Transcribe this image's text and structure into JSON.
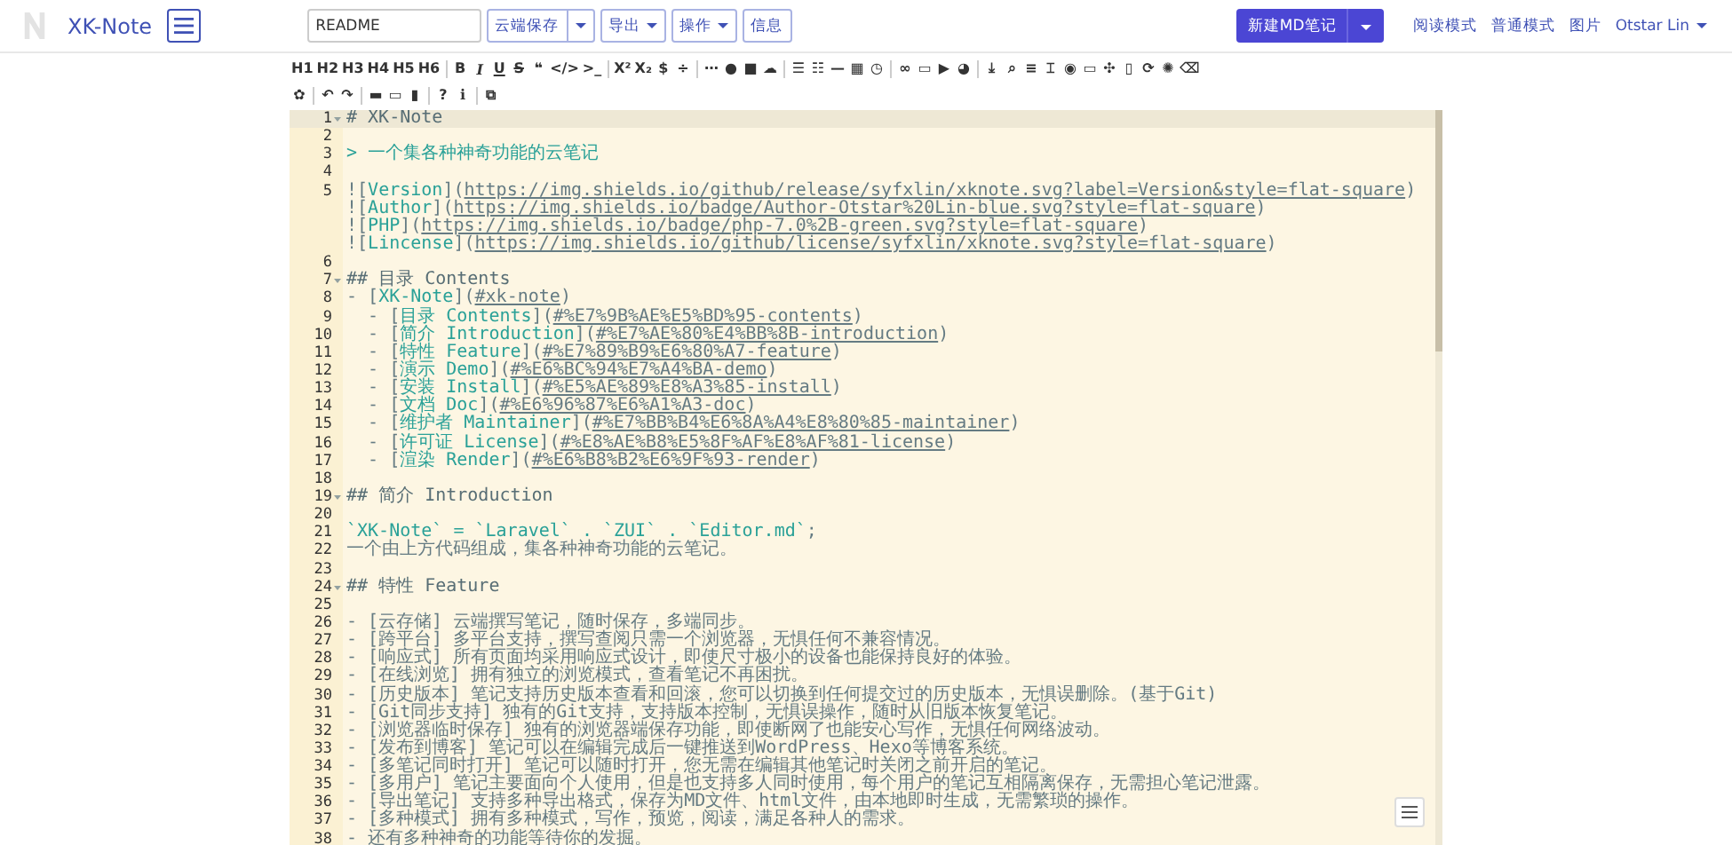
{
  "navbar": {
    "brand": "XK-Note",
    "filename": {
      "value": "README"
    },
    "buttons": [
      {
        "label": "云端保存",
        "kind": "split"
      },
      {
        "label": "导出",
        "kind": "dropdown"
      },
      {
        "label": "操作",
        "kind": "dropdown"
      },
      {
        "label": "信息",
        "kind": "plain"
      }
    ],
    "new_button": {
      "label": "新建MD笔记",
      "kind": "split"
    },
    "links": [
      "阅读模式",
      "普通模式",
      "图片"
    ],
    "user": {
      "label": "Otstar Lin",
      "kind": "dropdown"
    }
  },
  "toolbar": {
    "rows": [
      {
        "groups": [
          {
            "buttons": [
              {
                "text": "H1",
                "kind": "plain"
              },
              {
                "text": "H2",
                "kind": "plain"
              },
              {
                "text": "H3",
                "kind": "plain"
              },
              {
                "text": "H4",
                "kind": "plain"
              },
              {
                "text": "H5",
                "kind": "plain"
              },
              {
                "text": "H6",
                "kind": "plain"
              }
            ]
          },
          {
            "buttons": [
              {
                "text": "B",
                "kind": "bold"
              },
              {
                "text": "I",
                "kind": "italic"
              },
              {
                "text": "U",
                "kind": "underline"
              },
              {
                "text": "S",
                "kind": "strike"
              },
              {
                "text": "❝",
                "kind": "plain"
              },
              {
                "text": "</>",
                "kind": "plain"
              },
              {
                "text": ">_",
                "kind": "plain"
              }
            ]
          },
          {
            "buttons": [
              {
                "text": "X²",
                "kind": "plain"
              },
              {
                "text": "X₂",
                "kind": "plain"
              },
              {
                "text": "$",
                "kind": "plain"
              },
              {
                "text": "÷",
                "kind": "plain"
              }
            ]
          },
          {
            "buttons": [
              {
                "text": "⋯",
                "kind": "plain"
              },
              {
                "text": "●",
                "kind": "plain"
              },
              {
                "text": "■",
                "kind": "plain"
              },
              {
                "text": "☁",
                "kind": "plain"
              }
            ]
          },
          {
            "buttons": [
              {
                "text": "☰",
                "kind": "plain"
              },
              {
                "text": "☷",
                "kind": "plain"
              },
              {
                "text": "—",
                "kind": "plain"
              },
              {
                "text": "▦",
                "kind": "plain"
              },
              {
                "text": "◷",
                "kind": "plain"
              }
            ]
          },
          {
            "buttons": [
              {
                "text": "∞",
                "kind": "plain"
              },
              {
                "text": "▭",
                "kind": "plain"
              },
              {
                "text": "▶",
                "kind": "plain"
              },
              {
                "text": "◕",
                "kind": "plain"
              }
            ]
          },
          {
            "buttons": [
              {
                "text": "⤓",
                "kind": "plain"
              },
              {
                "text": "⌕",
                "kind": "plain"
              },
              {
                "text": "≡",
                "kind": "plain"
              },
              {
                "text": "⌶",
                "kind": "plain"
              },
              {
                "text": "◉",
                "kind": "plain"
              },
              {
                "text": "▭",
                "kind": "plain"
              },
              {
                "text": "✣",
                "kind": "plain"
              },
              {
                "text": "▯",
                "kind": "plain"
              },
              {
                "text": "⟳",
                "kind": "plain"
              },
              {
                "text": "✺",
                "kind": "plain"
              },
              {
                "text": "⌫",
                "kind": "plain"
              }
            ]
          }
        ]
      },
      {
        "groups": [
          {
            "buttons": [
              {
                "text": "✿",
                "kind": "plain"
              }
            ]
          },
          {
            "buttons": [
              {
                "text": "↶",
                "kind": "plain"
              },
              {
                "text": "↷",
                "kind": "plain"
              }
            ]
          },
          {
            "buttons": [
              {
                "text": "▬",
                "kind": "plain"
              },
              {
                "text": "▭",
                "kind": "plain"
              },
              {
                "text": "▮",
                "kind": "plain"
              }
            ]
          },
          {
            "buttons": [
              {
                "text": "?",
                "kind": "plain"
              },
              {
                "text": "ℹ",
                "kind": "plain"
              }
            ]
          },
          {
            "buttons": [
              {
                "text": "⧉",
                "kind": "plain"
              }
            ]
          }
        ]
      }
    ]
  },
  "editor": {
    "lines": [
      {
        "number": "1",
        "fold": true,
        "active": true,
        "segments": [
          {
            "kind": "heading",
            "text": "# XK-Note"
          }
        ]
      },
      {
        "number": "2",
        "fold": false,
        "active": false
      },
      {
        "number": "3",
        "fold": false,
        "active": false,
        "segments": [
          {
            "kind": "quote",
            "text": "> 一个集各种神奇功能的云笔记"
          }
        ]
      },
      {
        "number": "4",
        "fold": false,
        "active": false
      },
      {
        "number": "5",
        "fold": false,
        "active": false,
        "segments": [
          {
            "kind": "plain",
            "text": "!["
          },
          {
            "kind": "link",
            "text": "Version"
          },
          {
            "kind": "plain",
            "text": "]("
          },
          {
            "kind": "url",
            "text": "https://img.shields.io/github/release/syfxlin/xknote.svg?label=Version&style=flat-square"
          },
          {
            "kind": "plain",
            "text": ")"
          }
        ]
      },
      {
        "fold": false,
        "active": false,
        "segments": [
          {
            "kind": "plain",
            "text": "!["
          },
          {
            "kind": "link",
            "text": "Author"
          },
          {
            "kind": "plain",
            "text": "]("
          },
          {
            "kind": "url",
            "text": "https://img.shields.io/badge/Author-Otstar%20Lin-blue.svg?style=flat-square"
          },
          {
            "kind": "plain",
            "text": ")"
          }
        ]
      },
      {
        "fold": false,
        "active": false,
        "segments": [
          {
            "kind": "plain",
            "text": "!["
          },
          {
            "kind": "link",
            "text": "PHP"
          },
          {
            "kind": "plain",
            "text": "]("
          },
          {
            "kind": "url",
            "text": "https://img.shields.io/badge/php-7.0%2B-green.svg?style=flat-square"
          },
          {
            "kind": "plain",
            "text": ")"
          }
        ]
      },
      {
        "fold": false,
        "active": false,
        "segments": [
          {
            "kind": "plain",
            "text": "!["
          },
          {
            "kind": "link",
            "text": "Lincense"
          },
          {
            "kind": "plain",
            "text": "]("
          },
          {
            "kind": "url",
            "text": "https://img.shields.io/github/license/syfxlin/xknote.svg?style=flat-square"
          },
          {
            "kind": "plain",
            "text": ")"
          }
        ]
      },
      {
        "number": "6",
        "fold": false,
        "active": false
      },
      {
        "number": "7",
        "fold": true,
        "active": false,
        "segments": [
          {
            "kind": "heading",
            "text": "## 目录 Contents"
          }
        ]
      },
      {
        "number": "8",
        "fold": false,
        "active": false,
        "segments": [
          {
            "kind": "plain",
            "text": "- ["
          },
          {
            "kind": "link",
            "text": "XK-Note"
          },
          {
            "kind": "plain",
            "text": "]("
          },
          {
            "kind": "url",
            "text": "#xk-note"
          },
          {
            "kind": "plain",
            "text": ")"
          }
        ]
      },
      {
        "number": "9",
        "fold": false,
        "active": false,
        "segments": [
          {
            "kind": "plain",
            "text": "  - ["
          },
          {
            "kind": "link",
            "text": "目录 Contents"
          },
          {
            "kind": "plain",
            "text": "]("
          },
          {
            "kind": "url",
            "text": "#%E7%9B%AE%E5%BD%95-contents"
          },
          {
            "kind": "plain",
            "text": ")"
          }
        ]
      },
      {
        "number": "10",
        "fold": false,
        "active": false,
        "segments": [
          {
            "kind": "plain",
            "text": "  - ["
          },
          {
            "kind": "link",
            "text": "简介 Introduction"
          },
          {
            "kind": "plain",
            "text": "]("
          },
          {
            "kind": "url",
            "text": "#%E7%AE%80%E4%BB%8B-introduction"
          },
          {
            "kind": "plain",
            "text": ")"
          }
        ]
      },
      {
        "number": "11",
        "fold": false,
        "active": false,
        "segments": [
          {
            "kind": "plain",
            "text": "  - ["
          },
          {
            "kind": "link",
            "text": "特性 Feature"
          },
          {
            "kind": "plain",
            "text": "]("
          },
          {
            "kind": "url",
            "text": "#%E7%89%B9%E6%80%A7-feature"
          },
          {
            "kind": "plain",
            "text": ")"
          }
        ]
      },
      {
        "number": "12",
        "fold": false,
        "active": false,
        "segments": [
          {
            "kind": "plain",
            "text": "  - ["
          },
          {
            "kind": "link",
            "text": "演示 Demo"
          },
          {
            "kind": "plain",
            "text": "]("
          },
          {
            "kind": "url",
            "text": "#%E6%BC%94%E7%A4%BA-demo"
          },
          {
            "kind": "plain",
            "text": ")"
          }
        ]
      },
      {
        "number": "13",
        "fold": false,
        "active": false,
        "segments": [
          {
            "kind": "plain",
            "text": "  - ["
          },
          {
            "kind": "link",
            "text": "安装 Install"
          },
          {
            "kind": "plain",
            "text": "]("
          },
          {
            "kind": "url",
            "text": "#%E5%AE%89%E8%A3%85-install"
          },
          {
            "kind": "plain",
            "text": ")"
          }
        ]
      },
      {
        "number": "14",
        "fold": false,
        "active": false,
        "segments": [
          {
            "kind": "plain",
            "text": "  - ["
          },
          {
            "kind": "link",
            "text": "文档 Doc"
          },
          {
            "kind": "plain",
            "text": "]("
          },
          {
            "kind": "url",
            "text": "#%E6%96%87%E6%A1%A3-doc"
          },
          {
            "kind": "plain",
            "text": ")"
          }
        ]
      },
      {
        "number": "15",
        "fold": false,
        "active": false,
        "segments": [
          {
            "kind": "plain",
            "text": "  - ["
          },
          {
            "kind": "link",
            "text": "维护者 Maintainer"
          },
          {
            "kind": "plain",
            "text": "]("
          },
          {
            "kind": "url",
            "text": "#%E7%BB%B4%E6%8A%A4%E8%80%85-maintainer"
          },
          {
            "kind": "plain",
            "text": ")"
          }
        ]
      },
      {
        "number": "16",
        "fold": false,
        "active": false,
        "segments": [
          {
            "kind": "plain",
            "text": "  - ["
          },
          {
            "kind": "link",
            "text": "许可证 License"
          },
          {
            "kind": "plain",
            "text": "]("
          },
          {
            "kind": "url",
            "text": "#%E8%AE%B8%E5%8F%AF%E8%AF%81-license"
          },
          {
            "kind": "plain",
            "text": ")"
          }
        ]
      },
      {
        "number": "17",
        "fold": false,
        "active": false,
        "segments": [
          {
            "kind": "plain",
            "text": "  - ["
          },
          {
            "kind": "link",
            "text": "渲染 Render"
          },
          {
            "kind": "plain",
            "text": "]("
          },
          {
            "kind": "url",
            "text": "#%E6%B8%B2%E6%9F%93-render"
          },
          {
            "kind": "plain",
            "text": ")"
          }
        ]
      },
      {
        "number": "18",
        "fold": false,
        "active": false
      },
      {
        "number": "19",
        "fold": true,
        "active": false,
        "segments": [
          {
            "kind": "heading",
            "text": "## 简介 Introduction"
          }
        ]
      },
      {
        "number": "20",
        "fold": false,
        "active": false
      },
      {
        "number": "21",
        "fold": false,
        "active": false,
        "segments": [
          {
            "kind": "code",
            "text": "`XK-Note` = `Laravel` . `ZUI` . `Editor.md`"
          },
          {
            "kind": "plain",
            "text": ";"
          }
        ]
      },
      {
        "number": "22",
        "fold": false,
        "active": false,
        "segments": [
          {
            "kind": "plain",
            "text": "一个由上方代码组成，集各种神奇功能的云笔记。"
          }
        ]
      },
      {
        "number": "23",
        "fold": false,
        "active": false
      },
      {
        "number": "24",
        "fold": true,
        "active": false,
        "segments": [
          {
            "kind": "heading",
            "text": "## 特性 Feature"
          }
        ]
      },
      {
        "number": "25",
        "fold": false,
        "active": false
      },
      {
        "number": "26",
        "fold": false,
        "active": false,
        "segments": [
          {
            "kind": "plain",
            "text": "- [云存储] 云端撰写笔记，随时保存，多端同步。"
          }
        ]
      },
      {
        "number": "27",
        "fold": false,
        "active": false,
        "segments": [
          {
            "kind": "plain",
            "text": "- [跨平台] 多平台支持，撰写查阅只需一个浏览器，无惧任何不兼容情况。"
          }
        ]
      },
      {
        "number": "28",
        "fold": false,
        "active": false,
        "segments": [
          {
            "kind": "plain",
            "text": "- [响应式] 所有页面均采用响应式设计，即使尺寸极小的设备也能保持良好的体验。"
          }
        ]
      },
      {
        "number": "29",
        "fold": false,
        "active": false,
        "segments": [
          {
            "kind": "plain",
            "text": "- [在线浏览] 拥有独立的浏览模式，查看笔记不再困扰。"
          }
        ]
      },
      {
        "number": "30",
        "fold": false,
        "active": false,
        "segments": [
          {
            "kind": "plain",
            "text": "- [历史版本] 笔记支持历史版本查看和回滚，您可以切换到任何提交过的历史版本，无惧误删除。(基于Git)"
          }
        ]
      },
      {
        "number": "31",
        "fold": false,
        "active": false,
        "segments": [
          {
            "kind": "plain",
            "text": "- [Git同步支持] 独有的Git支持，支持版本控制，无惧误操作，随时从旧版本恢复笔记。"
          }
        ]
      },
      {
        "number": "32",
        "fold": false,
        "active": false,
        "segments": [
          {
            "kind": "plain",
            "text": "- [浏览器临时保存] 独有的浏览器端保存功能，即使断网了也能安心写作，无惧任何网络波动。"
          }
        ]
      },
      {
        "number": "33",
        "fold": false,
        "active": false,
        "segments": [
          {
            "kind": "plain",
            "text": "- [发布到博客] 笔记可以在编辑完成后一键推送到WordPress、Hexo等博客系统。"
          }
        ]
      },
      {
        "number": "34",
        "fold": false,
        "active": false,
        "segments": [
          {
            "kind": "plain",
            "text": "- [多笔记同时打开] 笔记可以随时打开，您无需在编辑其他笔记时关闭之前开启的笔记。"
          }
        ]
      },
      {
        "number": "35",
        "fold": false,
        "active": false,
        "segments": [
          {
            "kind": "plain",
            "text": "- [多用户] 笔记主要面向个人使用，但是也支持多人同时使用，每个用户的笔记互相隔离保存，无需担心笔记泄露。"
          }
        ]
      },
      {
        "number": "36",
        "fold": false,
        "active": false,
        "segments": [
          {
            "kind": "plain",
            "text": "- [导出笔记] 支持多种导出格式，保存为MD文件、html文件，由本地即时生成，无需繁琐的操作。"
          }
        ]
      },
      {
        "number": "37",
        "fold": false,
        "active": false,
        "segments": [
          {
            "kind": "plain",
            "text": "- [多种模式] 拥有多种模式，写作，预览，阅读，满足各种人的需求。"
          }
        ]
      },
      {
        "number": "38",
        "fold": false,
        "active": false,
        "segments": [
          {
            "kind": "plain",
            "text": "- 还有多种神奇的功能等待你的发掘。"
          }
        ]
      }
    ]
  }
}
